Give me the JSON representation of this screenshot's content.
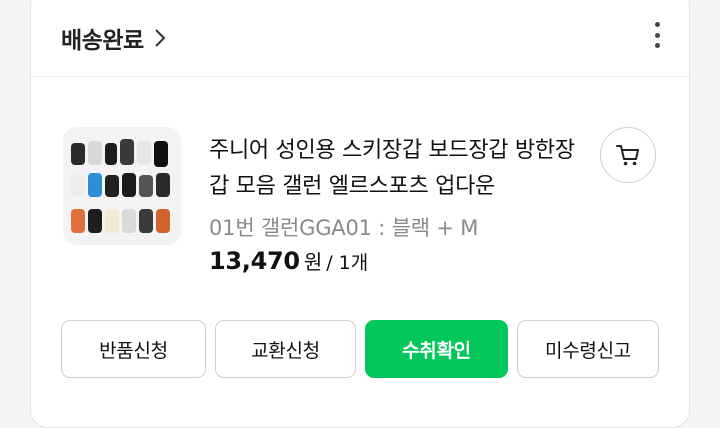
{
  "header": {
    "status_label": "배송완료"
  },
  "product": {
    "name": "주니어 성인용 스키장갑 보드장갑 방한장갑 모음 갤런 엘르스포츠 업다운",
    "option": "01번 갤런GGA01 : 블랙 + M",
    "price": "13,470",
    "currency_unit": "원",
    "quantity": "/ 1개",
    "thumbnail_icon": "glove-collection-image"
  },
  "actions": {
    "return_label": "반품신청",
    "exchange_label": "교환신청",
    "confirm_label": "수취확인",
    "not_received_label": "미수령신고"
  },
  "colors": {
    "accent": "#03c75a",
    "border": "#cfcfd3",
    "muted_text": "#8a8a8e"
  }
}
